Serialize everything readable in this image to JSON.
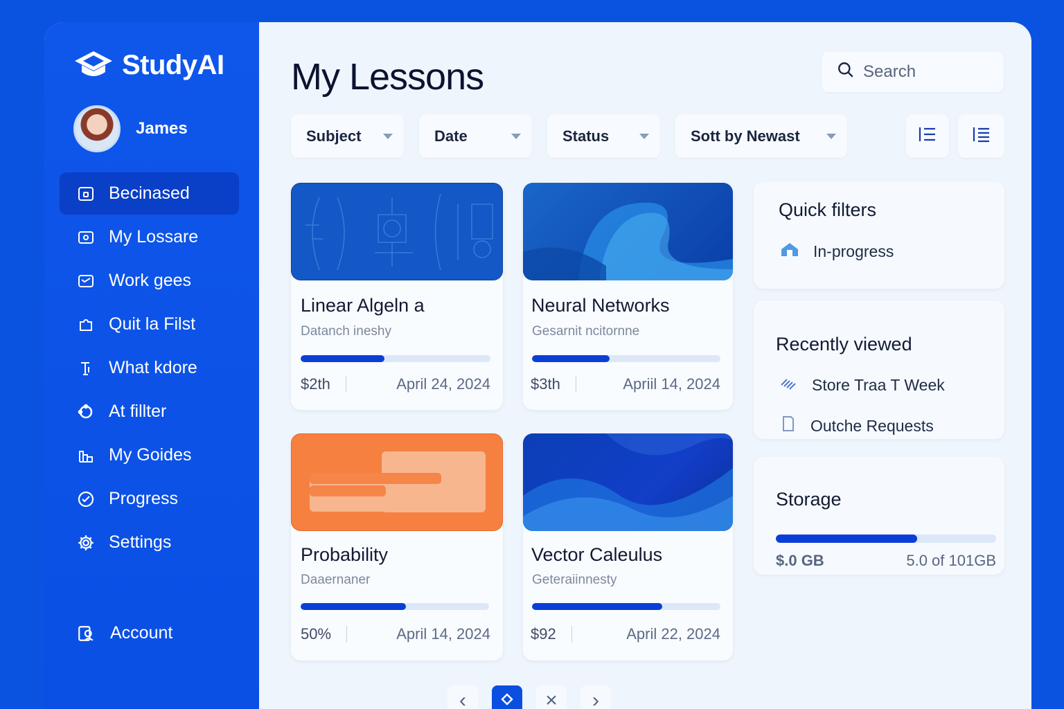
{
  "app": {
    "name": "StudyAI"
  },
  "user": {
    "name": "James"
  },
  "sidebar": {
    "items": [
      {
        "label": "Becinased",
        "icon": "home-icon",
        "active": true
      },
      {
        "label": "My Lossare",
        "icon": "book-icon"
      },
      {
        "label": "Work gees",
        "icon": "folder-icon"
      },
      {
        "label": "Quit la Filst",
        "icon": "puzzle-icon"
      },
      {
        "label": "What kdore",
        "icon": "text-icon"
      },
      {
        "label": "At fillter",
        "icon": "target-icon"
      },
      {
        "label": "My Goides",
        "icon": "chart-icon"
      },
      {
        "label": "Progress",
        "icon": "check-circle-icon"
      },
      {
        "label": "Settings",
        "icon": "gear-icon"
      }
    ],
    "account_label": "Account"
  },
  "main": {
    "title": "My Lessons",
    "search_placeholder": "Search",
    "filters": [
      "Subject",
      "Date",
      "Status",
      "Sott by Newast"
    ]
  },
  "cards": [
    {
      "title": "Linear Algeln a",
      "subtitle": "Datanch ineshy",
      "progress": 0.44,
      "value": "$2th",
      "date": "April 24, 2024",
      "theme": "blueprint"
    },
    {
      "title": "Neural Networks",
      "subtitle": "Gesarnit ncitornne",
      "progress": 0.41,
      "value": "$3th",
      "date": "Apriil 14, 2024",
      "theme": "blue-waves"
    },
    {
      "title": "Probability",
      "subtitle": "Daaernaner",
      "progress": 0.56,
      "value": "50%",
      "date": "April 14, 2024",
      "theme": "orange"
    },
    {
      "title": "Vector Caleulus",
      "subtitle": "Geteraiinnesty",
      "progress": 0.69,
      "value": "$92",
      "date": "April 22, 2024",
      "theme": "blue-flow"
    }
  ],
  "quick_filters": {
    "title": "Quick filters",
    "items": [
      {
        "label": "In-progress",
        "icon": "house-icon"
      }
    ]
  },
  "recently_viewed": {
    "title": "Recently viewed",
    "items": [
      {
        "label": "Store Traa T Week",
        "icon": "lines-icon"
      },
      {
        "label": "Outche Requests",
        "icon": "document-icon"
      }
    ]
  },
  "storage": {
    "title": "Storage",
    "used_label": "$.0 GB",
    "total_label": "5.0 of 101GB",
    "fraction": 0.64
  },
  "pagination": {
    "prev": "‹",
    "current_icon": "diamond-icon",
    "close": "×",
    "next": "›"
  },
  "colors": {
    "brand": "#0a52e0",
    "accent": "#0a3fd7",
    "orange": "#f6803f"
  }
}
